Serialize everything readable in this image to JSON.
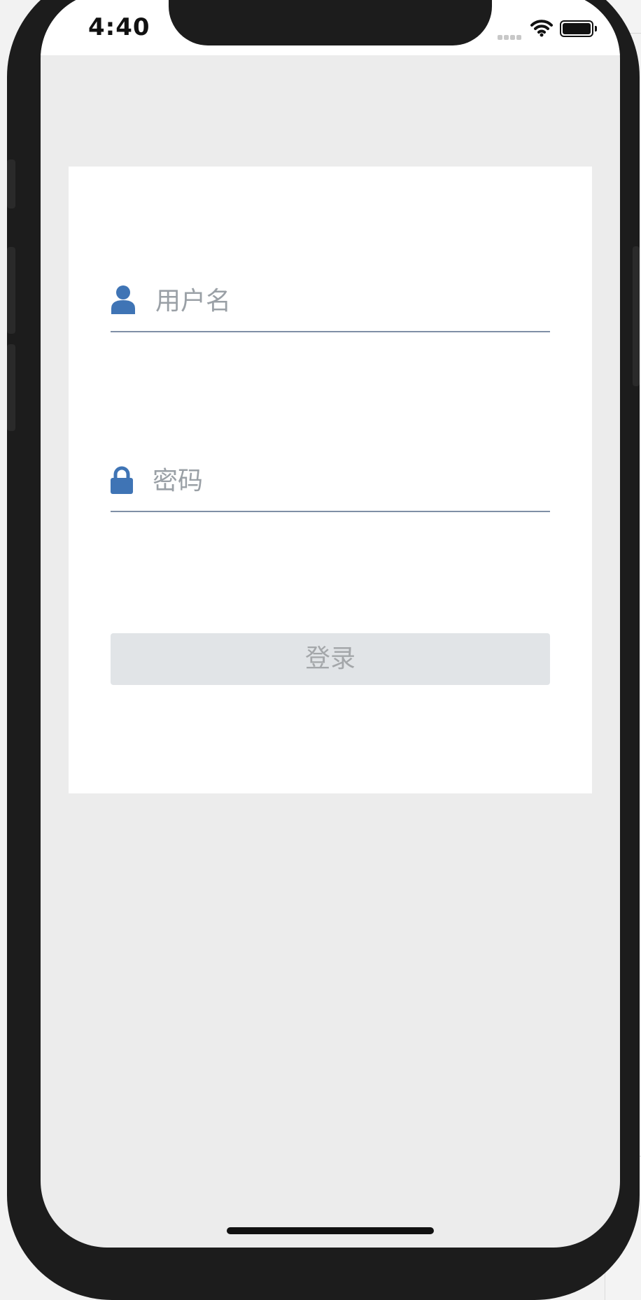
{
  "status_bar": {
    "time": "4:40"
  },
  "login_form": {
    "username_placeholder": "用户名",
    "password_placeholder": "密码",
    "login_button_label": "登录"
  },
  "colors": {
    "accent": "#3f74b5",
    "screen_background": "#ececec",
    "card_background": "#ffffff",
    "button_background": "#e1e4e7"
  },
  "icons": {
    "username": "user-icon",
    "password": "lock-icon"
  }
}
